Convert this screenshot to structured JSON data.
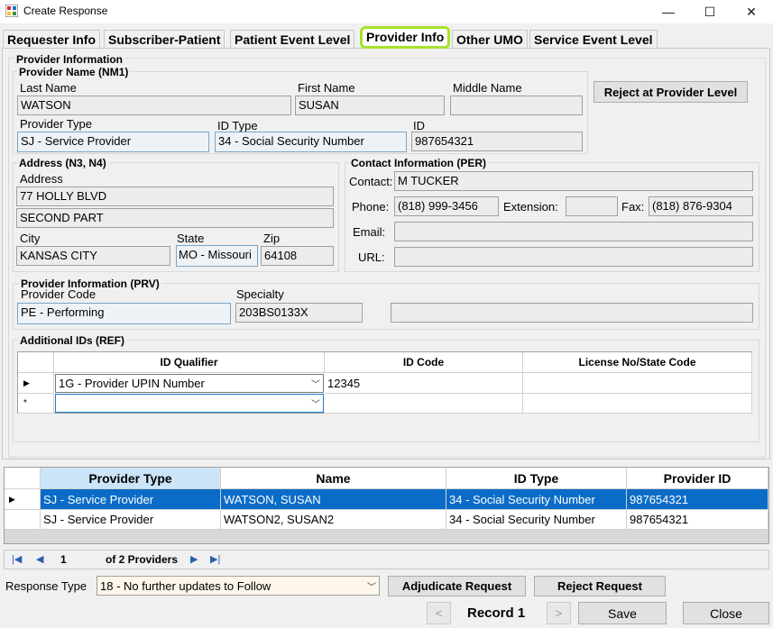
{
  "window": {
    "title": "Create Response",
    "minimize_glyph": "—",
    "maximize_glyph": "☐",
    "close_glyph": "✕"
  },
  "tabs": [
    {
      "label": "Requester Info"
    },
    {
      "label": "Subscriber-Patient"
    },
    {
      "label": "Patient Event Level"
    },
    {
      "label": "Provider Info"
    },
    {
      "label": "Other UMO"
    },
    {
      "label": "Service Event Level"
    }
  ],
  "provider_info": {
    "group_title": "Provider Information",
    "name_group_title": "Provider Name (NM1)",
    "last_name_label": "Last Name",
    "last_name": "WATSON",
    "first_name_label": "First Name",
    "first_name": "SUSAN",
    "middle_name_label": "Middle Name",
    "middle_name": "",
    "provider_type_label": "Provider Type",
    "provider_type": "SJ - Service Provider",
    "id_type_label": "ID Type",
    "id_type": "34 - Social Security Number",
    "id_label": "ID",
    "id": "987654321",
    "reject_button": "Reject at Provider Level"
  },
  "address": {
    "group_title": "Address (N3, N4)",
    "address_label": "Address",
    "line1": "77 HOLLY BLVD",
    "line2": "SECOND PART",
    "city_label": "City",
    "city": "KANSAS CITY",
    "state_label": "State",
    "state": "MO - Missouri",
    "zip_label": "Zip",
    "zip": "64108"
  },
  "contact": {
    "group_title": "Contact Information (PER)",
    "contact_label": "Contact:",
    "contact": "M TUCKER",
    "phone_label": "Phone:",
    "phone": "(818) 999-3456",
    "extension_label": "Extension:",
    "extension": "",
    "fax_label": "Fax:",
    "fax": "(818) 876-9304",
    "email_label": "Email:",
    "email": "",
    "url_label": "URL:",
    "url": ""
  },
  "prv": {
    "group_title": "Provider Information (PRV)",
    "code_label": "Provider Code",
    "code": "PE - Performing",
    "specialty_label": "Specialty",
    "specialty": "203BS0133X",
    "specialty_desc": ""
  },
  "additional_ids": {
    "group_title": "Additional IDs (REF)",
    "columns": [
      "ID Qualifier",
      "ID Code",
      "License No/State Code"
    ],
    "rows": [
      {
        "indicator": "▶",
        "qualifier": "1G - Provider UPIN Number",
        "code": "12345",
        "license": ""
      },
      {
        "indicator": "*",
        "qualifier": "",
        "code": "",
        "license": ""
      }
    ]
  },
  "providers_list": {
    "columns": [
      "Provider Type",
      "Name",
      "ID Type",
      "Provider ID"
    ],
    "rows": [
      {
        "indicator": "▶",
        "type": "SJ - Service Provider",
        "name": "WATSON, SUSAN",
        "id_type": "34 - Social Security Number",
        "id": "987654321"
      },
      {
        "indicator": "",
        "type": "SJ - Service Provider",
        "name": "WATSON2, SUSAN2",
        "id_type": "34 - Social Security Number",
        "id": "987654321"
      }
    ]
  },
  "navigator": {
    "position": "1",
    "of_label": "of 2 Providers"
  },
  "footer": {
    "response_type_label": "Response Type",
    "response_type": "18 - No further updates to Follow",
    "adjudicate_button": "Adjudicate Request",
    "reject_button": "Reject Request",
    "prev_glyph": "<",
    "record_label": "Record 1",
    "next_glyph": ">",
    "save_button": "Save",
    "close_button": "Close"
  }
}
